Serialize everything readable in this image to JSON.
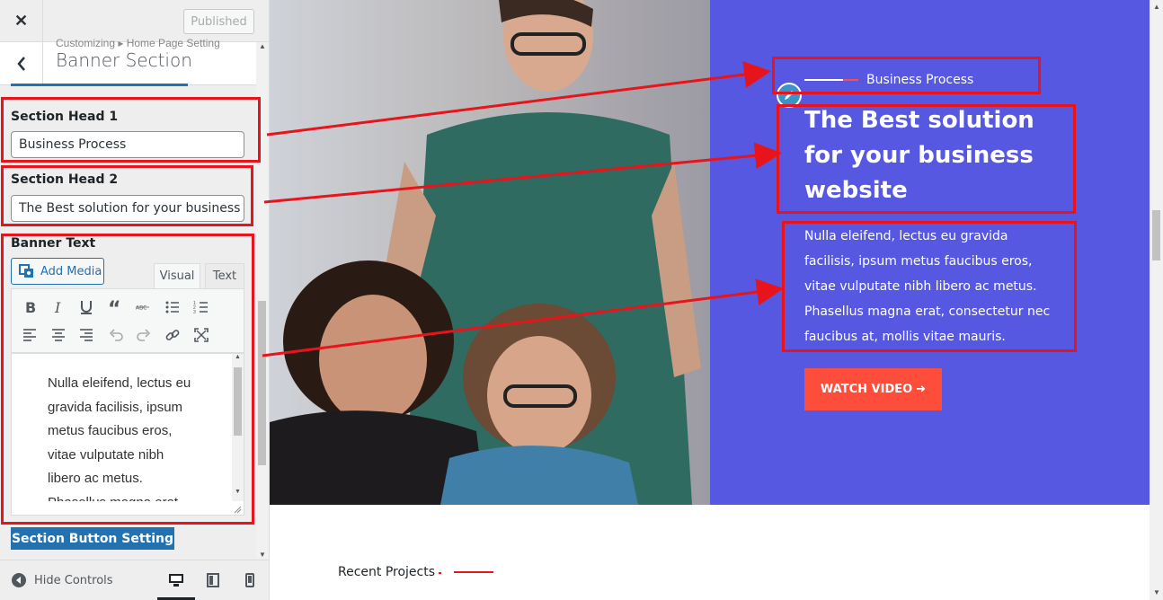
{
  "topbar": {
    "close_glyph": "✕",
    "published_label": "Published"
  },
  "section": {
    "back_glyph": "‹",
    "breadcrumb": "Customizing ▸ Home Page Setting",
    "title": "Banner Section"
  },
  "fields": {
    "head1_label": "Section Head 1",
    "head1_value": "Business Process",
    "head2_label": "Section Head 2",
    "head2_value": "The Best solution for your business website",
    "banner_label": "Banner Text"
  },
  "editor": {
    "add_media_label": "Add Media",
    "tab_visual": "Visual",
    "tab_text": "Text",
    "toolbar_icons": [
      "bold-icon",
      "italic-icon",
      "underline-icon",
      "blockquote-icon",
      "strikethrough-icon",
      "bullet-list-icon",
      "numbered-list-icon",
      "align-left-icon",
      "align-center-icon",
      "align-right-icon",
      "undo-icon",
      "redo-icon",
      "link-icon",
      "fullscreen-icon"
    ],
    "content": "Nulla eleifend, lectus eu gravida facilisis, ipsum metus faucibus eros, vitae vulputate nibh libero ac metus. Phasellus magna erat"
  },
  "section_button_label": "Section Button Setting",
  "footer": {
    "hide_controls_label": "Hide Controls",
    "devices": [
      "desktop-icon",
      "tablet-icon",
      "mobile-icon"
    ]
  },
  "hero": {
    "eyebrow": "Business Process",
    "title": "The Best solution for your business website",
    "text": "Nulla eleifend, lectus eu gravida facilisis, ipsum metus faucibus eros, vitae vulputate nibh libero ac metus. Phasellus magna erat, consectetur nec faucibus at, mollis vitae mauris.",
    "button_label": "WATCH VIDEO",
    "button_arrow": "➜"
  },
  "recent_projects_label": "Recent Projects",
  "colors": {
    "accent_blue": "#2271b1",
    "hero_overlay": "#5658e2",
    "cta_red": "#ff4d3c",
    "annotation_red": "#e8141b"
  }
}
